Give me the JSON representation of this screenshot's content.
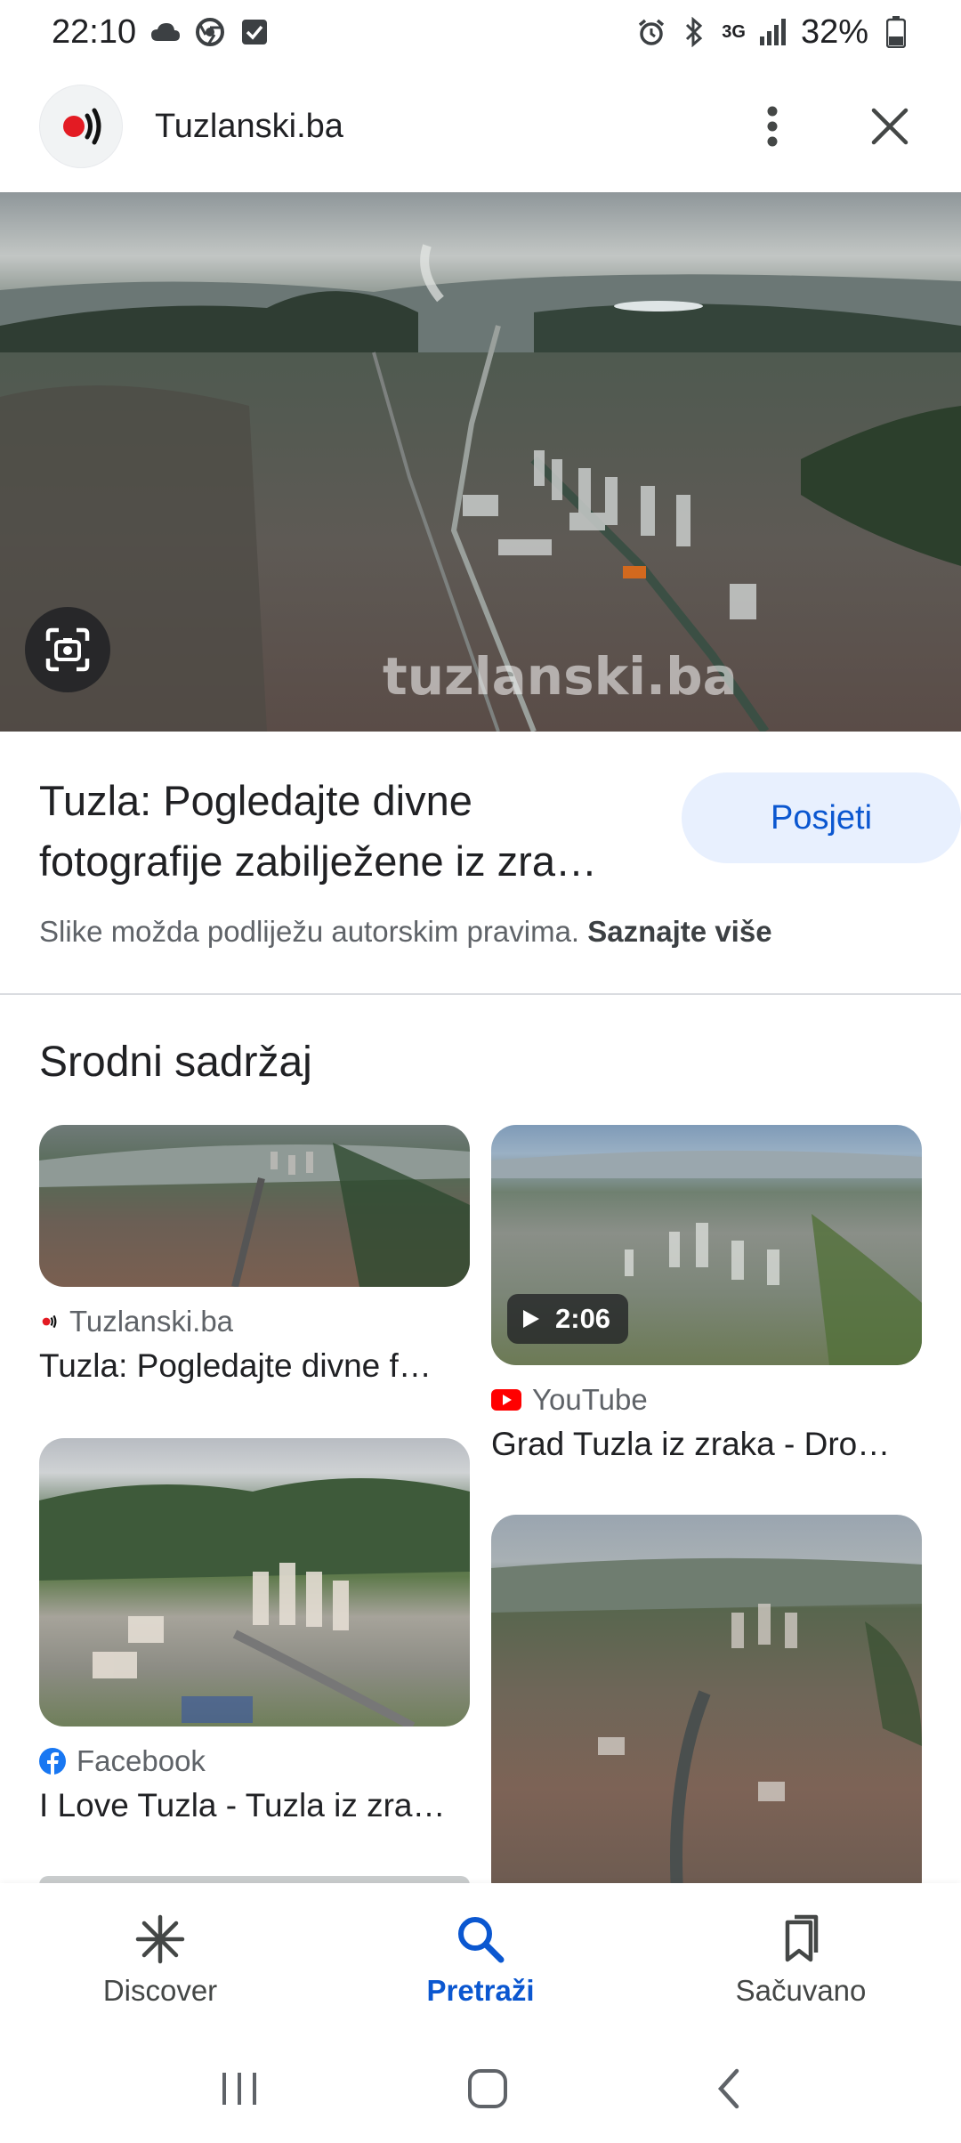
{
  "status_bar": {
    "time": "22:10",
    "network": "3G",
    "battery": "32%"
  },
  "header": {
    "site_name": "Tuzlanski.ba"
  },
  "hero": {
    "watermark": "tuzlanski.ba"
  },
  "result": {
    "title_line1": "Tuzla: Pogledajte divne",
    "title_line2": "fotografije zabilježene iz zra…",
    "visit_label": "Posjeti",
    "copyright_text": "Slike možda podliježu autorskim pravima.",
    "learn_more": "Saznajte više"
  },
  "related": {
    "heading": "Srodni sadržaj",
    "cards": [
      {
        "source": "Tuzlanski.ba",
        "title": "Tuzla: Pogledajte divne f…"
      },
      {
        "source": "YouTube",
        "title": "Grad Tuzla iz zraka - Dro…",
        "duration": "2:06"
      },
      {
        "source": "Facebook",
        "title": "I Love Tuzla - Tuzla iz zra…"
      },
      {
        "source": "",
        "title": ""
      }
    ]
  },
  "bottom_nav": {
    "discover": "Discover",
    "search": "Pretraži",
    "saved": "Sačuvano"
  },
  "colors": {
    "accent": "#0b57d0",
    "visit_bg": "#e8f0fe",
    "youtube_red": "#ff0000",
    "facebook_blue": "#1877f2",
    "brand_red": "#e31b23"
  }
}
